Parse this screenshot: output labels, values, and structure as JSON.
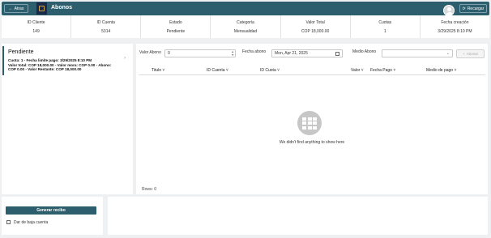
{
  "header": {
    "back_label": "Atras",
    "title": "Abonos",
    "reload_label": "Recargar",
    "color": "#2c5e6e"
  },
  "summary": [
    {
      "label": "ID Cliente",
      "value": "149"
    },
    {
      "label": "ID Cuenta",
      "value": "5314"
    },
    {
      "label": "Estado",
      "value": "Pendiente"
    },
    {
      "label": "Categoria",
      "value": "Mensualidad"
    },
    {
      "label": "Valor Total",
      "value": "COP 18,000.00"
    },
    {
      "label": "Cuotas",
      "value": "1"
    },
    {
      "label": "Fecha creación",
      "value": "3/29/2025 8:10 PM"
    }
  ],
  "card": {
    "title": "Pendiente",
    "line1": "Cuota: 1 - Fecha limite pago: 3/29/2025 8:10 PM",
    "line2": "Valor total: COP 18,000.00 - Valor mora: COP 0.00 - Abono:",
    "line3": "COP 0.00 - Valor Restante: COP 18,000.00"
  },
  "form": {
    "valor_abono_label": "Valor Abono",
    "valor_abono_value": "0",
    "fecha_abono_label": "Fecha abono",
    "fecha_abono_value": "Mon, Apr 21, 2025",
    "medio_abono_label": "Medio Abono",
    "medio_abono_value": "",
    "add_label": "Abonar"
  },
  "table": {
    "columns": [
      "Titulo",
      "ID Cuenta",
      "ID Cuota",
      "Valor",
      "Fecha Pago",
      "Medio de pago"
    ],
    "empty_message": "We didn't find anything to show here",
    "rows_label": "Rows: 0"
  },
  "bottom": {
    "generate_label": "Generar recibo",
    "checkbox_label": "Dar de baja cuenta"
  }
}
